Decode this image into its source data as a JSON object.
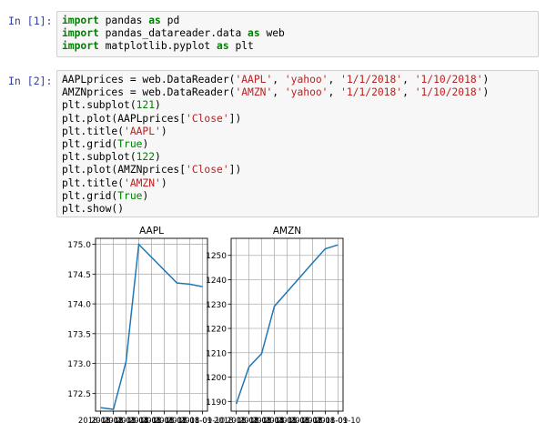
{
  "cells": [
    {
      "prompt": "In [1]:",
      "lines": [
        [
          {
            "t": "import",
            "c": "kw"
          },
          {
            "t": " pandas "
          },
          {
            "t": "as",
            "c": "kw"
          },
          {
            "t": " pd"
          }
        ],
        [
          {
            "t": "import",
            "c": "kw"
          },
          {
            "t": " pandas_datareader.data "
          },
          {
            "t": "as",
            "c": "kw"
          },
          {
            "t": " web"
          }
        ],
        [
          {
            "t": "import",
            "c": "kw"
          },
          {
            "t": " matplotlib.pyplot "
          },
          {
            "t": "as",
            "c": "kw"
          },
          {
            "t": " plt"
          }
        ]
      ]
    },
    {
      "prompt": "In [2]:",
      "lines": [
        [
          {
            "t": "AAPLprices = web.DataReader("
          },
          {
            "t": "'AAPL'",
            "c": "str"
          },
          {
            "t": ", "
          },
          {
            "t": "'yahoo'",
            "c": "str"
          },
          {
            "t": ", "
          },
          {
            "t": "'1/1/2018'",
            "c": "str"
          },
          {
            "t": ", "
          },
          {
            "t": "'1/10/2018'",
            "c": "str"
          },
          {
            "t": ")"
          }
        ],
        [
          {
            "t": "AMZNprices = web.DataReader("
          },
          {
            "t": "'AMZN'",
            "c": "str"
          },
          {
            "t": ", "
          },
          {
            "t": "'yahoo'",
            "c": "str"
          },
          {
            "t": ", "
          },
          {
            "t": "'1/1/2018'",
            "c": "str"
          },
          {
            "t": ", "
          },
          {
            "t": "'1/10/2018'",
            "c": "str"
          },
          {
            "t": ")"
          }
        ],
        [
          {
            "t": "plt.subplot("
          },
          {
            "t": "121",
            "c": "num"
          },
          {
            "t": ")"
          }
        ],
        [
          {
            "t": "plt.plot(AAPLprices["
          },
          {
            "t": "'Close'",
            "c": "str"
          },
          {
            "t": "])"
          }
        ],
        [
          {
            "t": "plt.title("
          },
          {
            "t": "'AAPL'",
            "c": "str"
          },
          {
            "t": ")"
          }
        ],
        [
          {
            "t": "plt.grid("
          },
          {
            "t": "True",
            "c": "bi"
          },
          {
            "t": ")"
          }
        ],
        [
          {
            "t": "plt.subplot("
          },
          {
            "t": "122",
            "c": "num"
          },
          {
            "t": ")"
          }
        ],
        [
          {
            "t": "plt.plot(AMZNprices["
          },
          {
            "t": "'Close'",
            "c": "str"
          },
          {
            "t": "])"
          }
        ],
        [
          {
            "t": "plt.title("
          },
          {
            "t": "'AMZN'",
            "c": "str"
          },
          {
            "t": ")"
          }
        ],
        [
          {
            "t": "plt.grid("
          },
          {
            "t": "True",
            "c": "bi"
          },
          {
            "t": ")"
          }
        ],
        [
          {
            "t": "plt.show()"
          }
        ]
      ]
    }
  ],
  "chart_data": [
    {
      "type": "line",
      "title": "AAPL",
      "xlabel": "",
      "ylabel": "",
      "x": [
        "2018-01-02",
        "2018-01-03",
        "2018-01-04",
        "2018-01-05",
        "2018-01-08",
        "2018-01-09",
        "2018-01-10"
      ],
      "values": [
        172.26,
        172.23,
        173.03,
        175.0,
        174.35,
        174.33,
        174.29
      ],
      "ylim": [
        172.2,
        175.1
      ],
      "yticks": [
        "172.5",
        "173.0",
        "173.5",
        "174.0",
        "174.5",
        "175.0"
      ],
      "xtick_labels": [
        "2018-01-02",
        "2018-01-03",
        "2018-01-04",
        "2018-01-05",
        "2018-01-06",
        "2018-01-07",
        "2018-01-08",
        "2018-01-09",
        "2018-01-10"
      ],
      "grid": true,
      "color": "#1f77b4"
    },
    {
      "type": "line",
      "title": "AMZN",
      "xlabel": "",
      "ylabel": "",
      "x": [
        "2018-01-02",
        "2018-01-03",
        "2018-01-04",
        "2018-01-05",
        "2018-01-08",
        "2018-01-09",
        "2018-01-10"
      ],
      "values": [
        1189.0,
        1204.2,
        1209.6,
        1229.1,
        1246.9,
        1252.7,
        1254.3
      ],
      "ylim": [
        1186,
        1257
      ],
      "yticks": [
        "1190",
        "1200",
        "1210",
        "1220",
        "1230",
        "1240",
        "1250"
      ],
      "xtick_labels": [
        "2018-01-02",
        "2018-01-03",
        "2018-01-04",
        "2018-01-05",
        "2018-01-06",
        "2018-01-07",
        "2018-01-08",
        "2018-01-09",
        "2018-01-10"
      ],
      "grid": true,
      "color": "#1f77b4"
    }
  ]
}
